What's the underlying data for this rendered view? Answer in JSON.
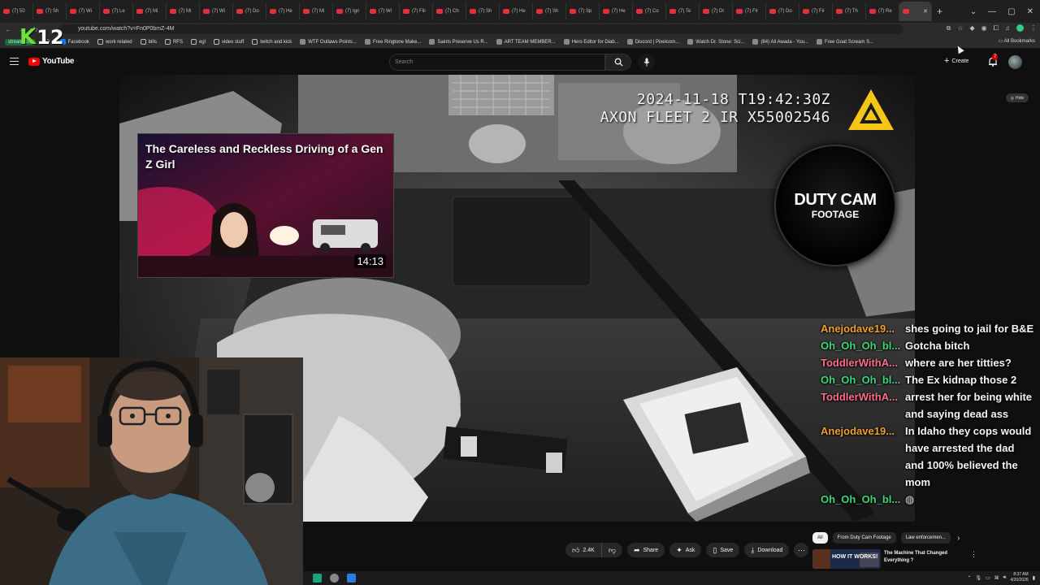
{
  "browser": {
    "tabs": [
      {
        "label": "(7) 50"
      },
      {
        "label": "(7) Sh"
      },
      {
        "label": "(7) Wi"
      },
      {
        "label": "(7) Le"
      },
      {
        "label": "(7) Mi"
      },
      {
        "label": "(7) Mi"
      },
      {
        "label": "(7) Wi"
      },
      {
        "label": "(7) Do"
      },
      {
        "label": "(7) He"
      },
      {
        "label": "(7) Mi"
      },
      {
        "label": "(7) Ign"
      },
      {
        "label": "(7) Wi"
      },
      {
        "label": "(7) Fili"
      },
      {
        "label": "(7) Ch"
      },
      {
        "label": "(7) Sh"
      },
      {
        "label": "(7) He"
      },
      {
        "label": "(7) Sh"
      },
      {
        "label": "(7) Sp"
      },
      {
        "label": "(7) He"
      },
      {
        "label": "(7) Co"
      },
      {
        "label": "(7) Te"
      },
      {
        "label": "(7) Dr"
      },
      {
        "label": "(7) Fir"
      },
      {
        "label": "(7) Do"
      },
      {
        "label": "(7) Fir"
      },
      {
        "label": "(7) Th"
      },
      {
        "label": "(7) Re"
      },
      {
        "label": ""
      }
    ],
    "new_tab": "+",
    "url": "youtube.com/watch?v=Fn0P0bmZ-4M",
    "bookmarks": [
      {
        "label": "streamstuff",
        "kind": "ss"
      },
      {
        "label": "",
        "kind": "grid"
      },
      {
        "label": "Facebook",
        "kind": "fb"
      },
      {
        "label": "work related",
        "kind": "folder"
      },
      {
        "label": "bills",
        "kind": "folder"
      },
      {
        "label": "RFS",
        "kind": "folder"
      },
      {
        "label": "egl",
        "kind": "folder"
      },
      {
        "label": "video stuff",
        "kind": "folder"
      },
      {
        "label": "twitch and kick",
        "kind": "folder"
      },
      {
        "label": "WTF Outlaws Points...",
        "kind": "site"
      },
      {
        "label": "Free Ringtone Make...",
        "kind": "site"
      },
      {
        "label": "Saints Preserve Us R...",
        "kind": "site"
      },
      {
        "label": "ART TEAM MEMBER...",
        "kind": "site"
      },
      {
        "label": "Hero Editor for Diab...",
        "kind": "site"
      },
      {
        "label": "Discord | Pixelcom...",
        "kind": "site"
      },
      {
        "label": "Watch Dr. Stone: Sci...",
        "kind": "site"
      },
      {
        "label": "(84) Ali Awada - You...",
        "kind": "site"
      },
      {
        "label": "Free Goat Scream S...",
        "kind": "site"
      }
    ],
    "all_bookmarks": "All Bookmarks"
  },
  "overlay_k12": {
    "k": "K",
    "num": "12"
  },
  "youtube": {
    "logo_text": "YouTube",
    "search_placeholder": "Search",
    "create_label": "Create",
    "notif_count": "7"
  },
  "video": {
    "timestamp_line1": "2024-11-18 T19:42:30Z",
    "timestamp_line2": "AXON FLEET 2 IR X55002546",
    "duty_cam_line1": "DUTY CAM",
    "duty_cam_line2": "FOOTAGE",
    "hide_label": "Hide",
    "endcard": {
      "title": "The Careless and Reckless Driving of a Gen Z Girl",
      "duration": "14:13"
    }
  },
  "chat": [
    {
      "user": "Anejodave19...",
      "text": "shes going to jail for B&E",
      "color": "#f0a030"
    },
    {
      "user": "Oh_Oh_Oh_bl...",
      "text": "Gotcha bitch",
      "color": "#3ed67a"
    },
    {
      "user": "ToddlerWithA...",
      "text": "where are her titties?",
      "color": "#ff6b8a"
    },
    {
      "user": "Oh_Oh_Oh_bl...",
      "text": "The Ex kidnap those 2",
      "color": "#3ed67a"
    },
    {
      "user": "ToddlerWithA...",
      "text": "arrest her for being white and saying dead ass",
      "color": "#ff6b8a"
    },
    {
      "user": "Anejodave19...",
      "text": "In Idaho they cops would have arrested the dad and 100% believed the mom",
      "color": "#f0a030"
    },
    {
      "user": "Oh_Oh_Oh_bl...",
      "text": "",
      "color": "#3ed67a"
    }
  ],
  "actions": {
    "likes": "2.4K",
    "share": "Share",
    "ask": "Ask",
    "save": "Save",
    "download": "Download"
  },
  "chips": [
    "All",
    "From Duty Cam Footage",
    "Law enforcemen..."
  ],
  "recommendation": {
    "thumb_text": "HOW IT WORKS!",
    "title": "The Machine That Changed Everything ?"
  },
  "taskbar": {
    "time": "8:37 AM",
    "date": "4/20/2026"
  }
}
